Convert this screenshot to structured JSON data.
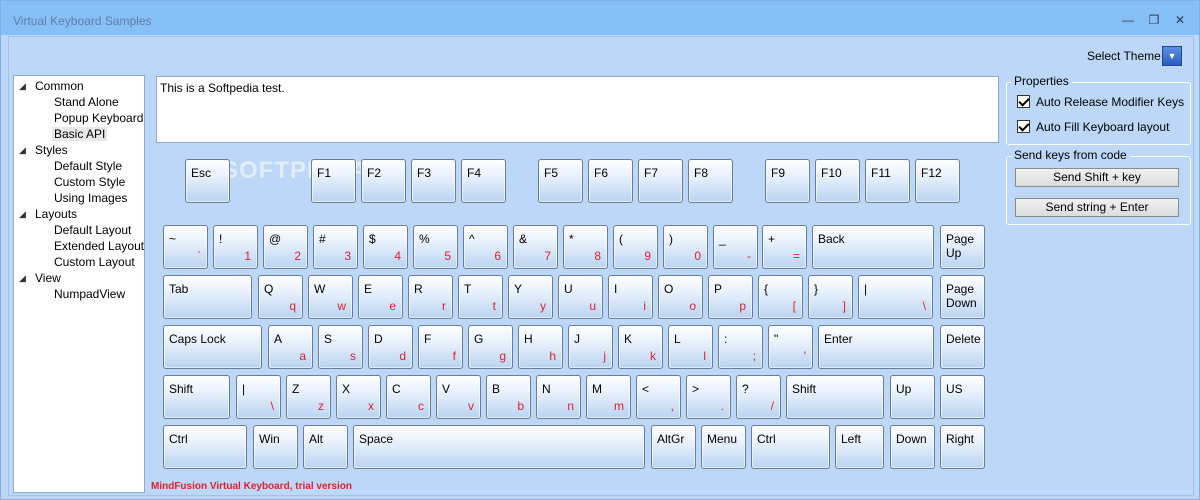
{
  "window": {
    "title": "Virtual Keyboard Samples",
    "minimize_glyph": "—",
    "maximize_glyph": "❐",
    "close_glyph": "✕"
  },
  "theme": {
    "label": "Select Theme",
    "dropdown_glyph": "▼"
  },
  "tree": {
    "groups": [
      {
        "label": "Common",
        "expand_glyph": "◢",
        "children": [
          "Stand Alone",
          "Popup Keyboard",
          "Basic API"
        ]
      },
      {
        "label": "Styles",
        "expand_glyph": "◢",
        "children": [
          "Default Style",
          "Custom Style",
          "Using Images"
        ]
      },
      {
        "label": "Layouts",
        "expand_glyph": "◢",
        "children": [
          "Default Layout",
          "Extended Layout",
          "Custom Layout"
        ]
      },
      {
        "label": "View",
        "expand_glyph": "◢",
        "children": [
          "NumpadView"
        ]
      }
    ],
    "selected": "Basic API"
  },
  "textbox": {
    "value": "This is a Softpedia test."
  },
  "watermark": "SOFTPEDIA",
  "keys": {
    "esc": {
      "p": "Esc"
    },
    "f": [
      "F1",
      "F2",
      "F3",
      "F4",
      "F5",
      "F6",
      "F7",
      "F8",
      "F9",
      "F10",
      "F11",
      "F12"
    ],
    "row1": [
      {
        "p": "~",
        "sec": "`"
      },
      {
        "p": "!",
        "sec": "1"
      },
      {
        "p": "@",
        "sec": "2"
      },
      {
        "p": "#",
        "sec": "3"
      },
      {
        "p": "$",
        "sec": "4"
      },
      {
        "p": "%",
        "sec": "5"
      },
      {
        "p": "^",
        "sec": "6"
      },
      {
        "p": "&",
        "sec": "7"
      },
      {
        "p": "*",
        "sec": "8"
      },
      {
        "p": "(",
        "sec": "9"
      },
      {
        "p": ")",
        "sec": "0"
      },
      {
        "p": "_",
        "sec": "-"
      },
      {
        "p": "+",
        "sec": "="
      },
      {
        "p": "Back"
      },
      {
        "p": "Page",
        "s": "Up"
      }
    ],
    "row2": [
      {
        "p": "Tab"
      },
      {
        "p": "Q",
        "sec": "q"
      },
      {
        "p": "W",
        "sec": "w"
      },
      {
        "p": "E",
        "sec": "e"
      },
      {
        "p": "R",
        "sec": "r"
      },
      {
        "p": "T",
        "sec": "t"
      },
      {
        "p": "Y",
        "sec": "y"
      },
      {
        "p": "U",
        "sec": "u"
      },
      {
        "p": "I",
        "sec": "i"
      },
      {
        "p": "O",
        "sec": "o"
      },
      {
        "p": "P",
        "sec": "p"
      },
      {
        "p": "{",
        "sec": "["
      },
      {
        "p": "}",
        "sec": "]"
      },
      {
        "p": "|",
        "sec": "\\"
      },
      {
        "p": "Page",
        "s": "Down"
      }
    ],
    "row3": [
      {
        "p": "Caps Lock"
      },
      {
        "p": "A",
        "sec": "a"
      },
      {
        "p": "S",
        "sec": "s"
      },
      {
        "p": "D",
        "sec": "d"
      },
      {
        "p": "F",
        "sec": "f"
      },
      {
        "p": "G",
        "sec": "g"
      },
      {
        "p": "H",
        "sec": "h"
      },
      {
        "p": "J",
        "sec": "j"
      },
      {
        "p": "K",
        "sec": "k"
      },
      {
        "p": "L",
        "sec": "l"
      },
      {
        "p": ":",
        "sec": ";"
      },
      {
        "p": "\"",
        "sec": "'"
      },
      {
        "p": "Enter"
      },
      {
        "p": "Delete"
      }
    ],
    "row4": [
      {
        "p": "Shift"
      },
      {
        "p": "|",
        "sec": "\\"
      },
      {
        "p": "Z",
        "sec": "z"
      },
      {
        "p": "X",
        "sec": "x"
      },
      {
        "p": "C",
        "sec": "c"
      },
      {
        "p": "V",
        "sec": "v"
      },
      {
        "p": "B",
        "sec": "b"
      },
      {
        "p": "N",
        "sec": "n"
      },
      {
        "p": "M",
        "sec": "m"
      },
      {
        "p": "<",
        "sec": ","
      },
      {
        "p": ">",
        "sec": "."
      },
      {
        "p": "?",
        "sec": "/"
      },
      {
        "p": "Shift"
      },
      {
        "p": "Up"
      },
      {
        "p": "US"
      }
    ],
    "row5": [
      {
        "p": "Ctrl"
      },
      {
        "p": "Win"
      },
      {
        "p": "Alt"
      },
      {
        "p": "Space"
      },
      {
        "p": "AltGr"
      },
      {
        "p": "Menu"
      },
      {
        "p": "Ctrl"
      },
      {
        "p": "Left"
      },
      {
        "p": "Down"
      },
      {
        "p": "Right"
      }
    ]
  },
  "footer": "MindFusion Virtual Keyboard, trial version",
  "properties": {
    "title": "Properties",
    "auto_release": {
      "label": "Auto Release Modifier Keys",
      "checked": true
    },
    "auto_fill": {
      "label": "Auto Fill Keyboard layout",
      "checked": true
    }
  },
  "send_keys": {
    "title": "Send keys from code",
    "shift_btn": "Send Shift + key",
    "string_btn": "Send string + Enter"
  },
  "colors": {
    "background": "#bcd7f7",
    "titlebar": "#86bff5",
    "secondary_key_text": "#e0202a"
  }
}
